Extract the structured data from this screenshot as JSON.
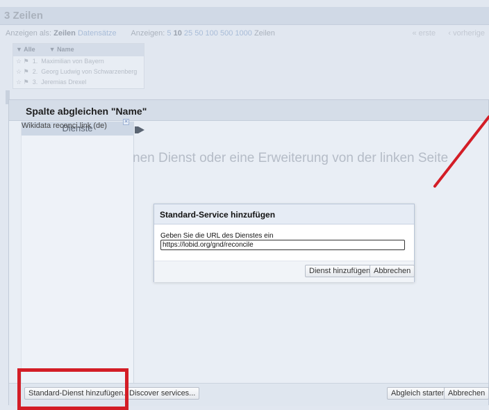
{
  "background": {
    "title": "3 Zeilen",
    "view_label": "Anzeigen als:",
    "view_rows": "Zeilen",
    "view_records": "Datensätze",
    "show_label": "Anzeigen:",
    "page_sizes": [
      "5",
      "10",
      "25",
      "50",
      "100",
      "500",
      "1000"
    ],
    "page_size_unit": "Zeilen",
    "pager_first": "« erste",
    "pager_prev": "‹ vorherige",
    "table": {
      "col_all": "Alle",
      "col_name": "Name",
      "rows": [
        {
          "num": "1.",
          "name": "Maximilian von Bayern"
        },
        {
          "num": "2.",
          "name": "Georg Ludwig von Schwarzenberg"
        },
        {
          "num": "3.",
          "name": "Jeremias Drexel"
        }
      ]
    }
  },
  "reconcile_dialog": {
    "title": "Spalte abgleichen \"Name\"",
    "services_header": "Dienste",
    "service_item": "Wikidata reconci.link (de)",
    "hint": "nen Dienst oder eine Erweiterung von der linken Seite",
    "add_standard_button": "Standard-Dienst hinzufügen...",
    "discover_button": "Discover services...",
    "start_button": "Abgleich starten",
    "cancel_button": "Abbrechen"
  },
  "add_service_dialog": {
    "title": "Standard-Service hinzufügen",
    "label": "Geben Sie die URL des Dienstes ein",
    "url_value": "https://lobid.org/gnd/reconcile",
    "add_button": "Dienst hinzufügen",
    "cancel_button": "Abbrechen"
  },
  "colors": {
    "annotation_red": "#d31d26",
    "header_bg": "#d5dde8"
  }
}
